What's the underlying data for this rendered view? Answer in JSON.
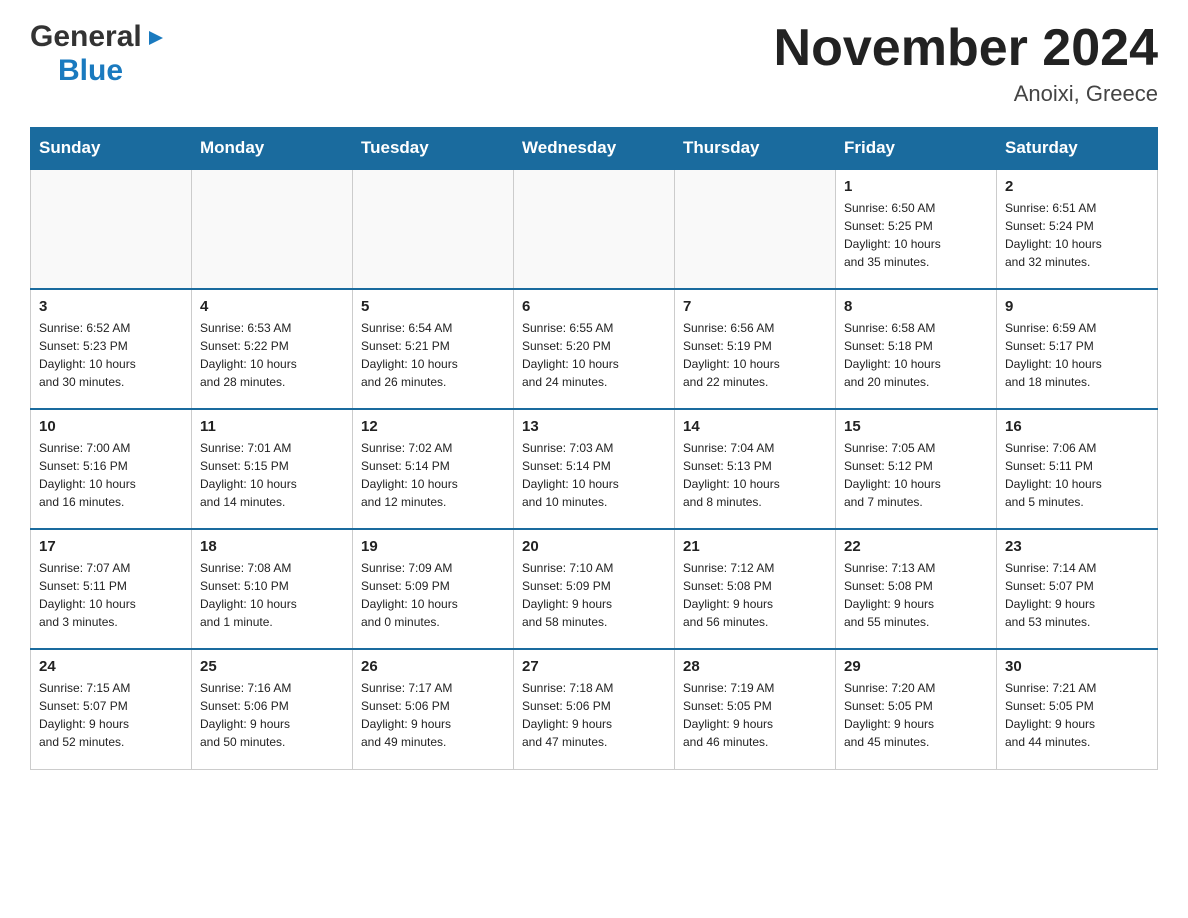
{
  "header": {
    "logo_general": "General",
    "logo_blue": "Blue",
    "month_title": "November 2024",
    "location": "Anoixi, Greece"
  },
  "days_of_week": [
    "Sunday",
    "Monday",
    "Tuesday",
    "Wednesday",
    "Thursday",
    "Friday",
    "Saturday"
  ],
  "weeks": [
    [
      {
        "day": "",
        "info": ""
      },
      {
        "day": "",
        "info": ""
      },
      {
        "day": "",
        "info": ""
      },
      {
        "day": "",
        "info": ""
      },
      {
        "day": "",
        "info": ""
      },
      {
        "day": "1",
        "info": "Sunrise: 6:50 AM\nSunset: 5:25 PM\nDaylight: 10 hours\nand 35 minutes."
      },
      {
        "day": "2",
        "info": "Sunrise: 6:51 AM\nSunset: 5:24 PM\nDaylight: 10 hours\nand 32 minutes."
      }
    ],
    [
      {
        "day": "3",
        "info": "Sunrise: 6:52 AM\nSunset: 5:23 PM\nDaylight: 10 hours\nand 30 minutes."
      },
      {
        "day": "4",
        "info": "Sunrise: 6:53 AM\nSunset: 5:22 PM\nDaylight: 10 hours\nand 28 minutes."
      },
      {
        "day": "5",
        "info": "Sunrise: 6:54 AM\nSunset: 5:21 PM\nDaylight: 10 hours\nand 26 minutes."
      },
      {
        "day": "6",
        "info": "Sunrise: 6:55 AM\nSunset: 5:20 PM\nDaylight: 10 hours\nand 24 minutes."
      },
      {
        "day": "7",
        "info": "Sunrise: 6:56 AM\nSunset: 5:19 PM\nDaylight: 10 hours\nand 22 minutes."
      },
      {
        "day": "8",
        "info": "Sunrise: 6:58 AM\nSunset: 5:18 PM\nDaylight: 10 hours\nand 20 minutes."
      },
      {
        "day": "9",
        "info": "Sunrise: 6:59 AM\nSunset: 5:17 PM\nDaylight: 10 hours\nand 18 minutes."
      }
    ],
    [
      {
        "day": "10",
        "info": "Sunrise: 7:00 AM\nSunset: 5:16 PM\nDaylight: 10 hours\nand 16 minutes."
      },
      {
        "day": "11",
        "info": "Sunrise: 7:01 AM\nSunset: 5:15 PM\nDaylight: 10 hours\nand 14 minutes."
      },
      {
        "day": "12",
        "info": "Sunrise: 7:02 AM\nSunset: 5:14 PM\nDaylight: 10 hours\nand 12 minutes."
      },
      {
        "day": "13",
        "info": "Sunrise: 7:03 AM\nSunset: 5:14 PM\nDaylight: 10 hours\nand 10 minutes."
      },
      {
        "day": "14",
        "info": "Sunrise: 7:04 AM\nSunset: 5:13 PM\nDaylight: 10 hours\nand 8 minutes."
      },
      {
        "day": "15",
        "info": "Sunrise: 7:05 AM\nSunset: 5:12 PM\nDaylight: 10 hours\nand 7 minutes."
      },
      {
        "day": "16",
        "info": "Sunrise: 7:06 AM\nSunset: 5:11 PM\nDaylight: 10 hours\nand 5 minutes."
      }
    ],
    [
      {
        "day": "17",
        "info": "Sunrise: 7:07 AM\nSunset: 5:11 PM\nDaylight: 10 hours\nand 3 minutes."
      },
      {
        "day": "18",
        "info": "Sunrise: 7:08 AM\nSunset: 5:10 PM\nDaylight: 10 hours\nand 1 minute."
      },
      {
        "day": "19",
        "info": "Sunrise: 7:09 AM\nSunset: 5:09 PM\nDaylight: 10 hours\nand 0 minutes."
      },
      {
        "day": "20",
        "info": "Sunrise: 7:10 AM\nSunset: 5:09 PM\nDaylight: 9 hours\nand 58 minutes."
      },
      {
        "day": "21",
        "info": "Sunrise: 7:12 AM\nSunset: 5:08 PM\nDaylight: 9 hours\nand 56 minutes."
      },
      {
        "day": "22",
        "info": "Sunrise: 7:13 AM\nSunset: 5:08 PM\nDaylight: 9 hours\nand 55 minutes."
      },
      {
        "day": "23",
        "info": "Sunrise: 7:14 AM\nSunset: 5:07 PM\nDaylight: 9 hours\nand 53 minutes."
      }
    ],
    [
      {
        "day": "24",
        "info": "Sunrise: 7:15 AM\nSunset: 5:07 PM\nDaylight: 9 hours\nand 52 minutes."
      },
      {
        "day": "25",
        "info": "Sunrise: 7:16 AM\nSunset: 5:06 PM\nDaylight: 9 hours\nand 50 minutes."
      },
      {
        "day": "26",
        "info": "Sunrise: 7:17 AM\nSunset: 5:06 PM\nDaylight: 9 hours\nand 49 minutes."
      },
      {
        "day": "27",
        "info": "Sunrise: 7:18 AM\nSunset: 5:06 PM\nDaylight: 9 hours\nand 47 minutes."
      },
      {
        "day": "28",
        "info": "Sunrise: 7:19 AM\nSunset: 5:05 PM\nDaylight: 9 hours\nand 46 minutes."
      },
      {
        "day": "29",
        "info": "Sunrise: 7:20 AM\nSunset: 5:05 PM\nDaylight: 9 hours\nand 45 minutes."
      },
      {
        "day": "30",
        "info": "Sunrise: 7:21 AM\nSunset: 5:05 PM\nDaylight: 9 hours\nand 44 minutes."
      }
    ]
  ]
}
